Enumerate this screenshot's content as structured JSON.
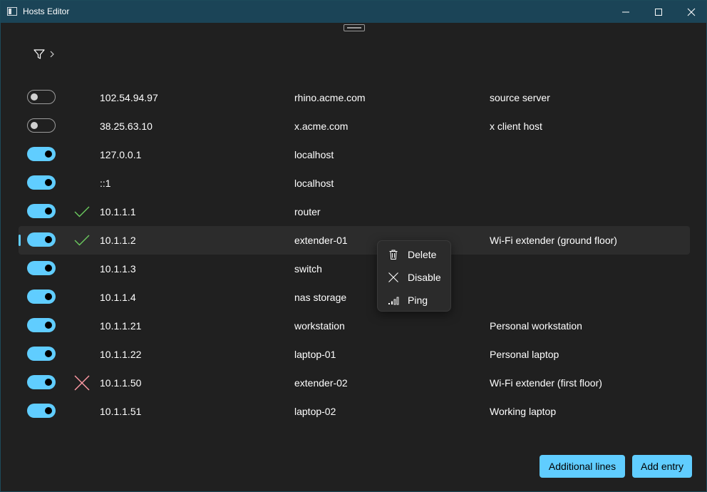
{
  "window": {
    "title": "Hosts Editor"
  },
  "colors": {
    "titlebar": "#1b4457",
    "background": "#202020",
    "accent": "#60cdff",
    "ok": "#6ccb5f",
    "error": "#ff99a4"
  },
  "toolbar": {
    "filter_icon": "filter-icon",
    "expand_icon": "chevron-right-icon"
  },
  "entries": [
    {
      "enabled": false,
      "status": "",
      "address": "102.54.94.97",
      "hosts": "rhino.acme.com",
      "comment": "source server"
    },
    {
      "enabled": false,
      "status": "",
      "address": "38.25.63.10",
      "hosts": "x.acme.com",
      "comment": "x client host"
    },
    {
      "enabled": true,
      "status": "",
      "address": "127.0.0.1",
      "hosts": "localhost",
      "comment": ""
    },
    {
      "enabled": true,
      "status": "",
      "address": "::1",
      "hosts": "localhost",
      "comment": ""
    },
    {
      "enabled": true,
      "status": "ok",
      "address": "10.1.1.1",
      "hosts": "router",
      "comment": ""
    },
    {
      "enabled": true,
      "status": "ok",
      "address": "10.1.1.2",
      "hosts": "extender-01",
      "comment": "Wi-Fi extender (ground floor)",
      "selected": true
    },
    {
      "enabled": true,
      "status": "",
      "address": "10.1.1.3",
      "hosts": "switch",
      "comment": ""
    },
    {
      "enabled": true,
      "status": "",
      "address": "10.1.1.4",
      "hosts": "nas storage",
      "comment": ""
    },
    {
      "enabled": true,
      "status": "",
      "address": "10.1.1.21",
      "hosts": "workstation",
      "comment": "Personal workstation"
    },
    {
      "enabled": true,
      "status": "",
      "address": "10.1.1.22",
      "hosts": "laptop-01",
      "comment": "Personal laptop"
    },
    {
      "enabled": true,
      "status": "error",
      "address": "10.1.1.50",
      "hosts": "extender-02",
      "comment": "Wi-Fi extender (first floor)"
    },
    {
      "enabled": true,
      "status": "",
      "address": "10.1.1.51",
      "hosts": "laptop-02",
      "comment": "Working laptop"
    }
  ],
  "context_menu": {
    "items": [
      {
        "label": "Delete",
        "icon": "trash-icon"
      },
      {
        "label": "Disable",
        "icon": "close-icon"
      },
      {
        "label": "Ping",
        "icon": "signal-bars-icon"
      }
    ]
  },
  "footer": {
    "additional_lines_label": "Additional lines",
    "add_entry_label": "Add entry"
  }
}
